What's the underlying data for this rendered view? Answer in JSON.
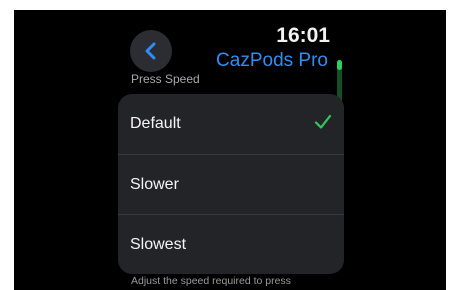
{
  "status": {
    "time": "16:01"
  },
  "header": {
    "back_icon": "chevron-left-icon",
    "app_title": "CazPods Pro"
  },
  "section": {
    "title": "Press Speed"
  },
  "options": [
    {
      "label": "Default",
      "selected": true
    },
    {
      "label": "Slower",
      "selected": false
    },
    {
      "label": "Slowest",
      "selected": false
    }
  ],
  "footer": {
    "text": "Adjust the speed required to press"
  },
  "colors": {
    "accent": "#2f8ef5",
    "check": "#34c759",
    "scroll": "#26d35d",
    "background": "#000000",
    "list_background": "#232428"
  },
  "icons": {
    "selected": "checkmark-icon"
  }
}
